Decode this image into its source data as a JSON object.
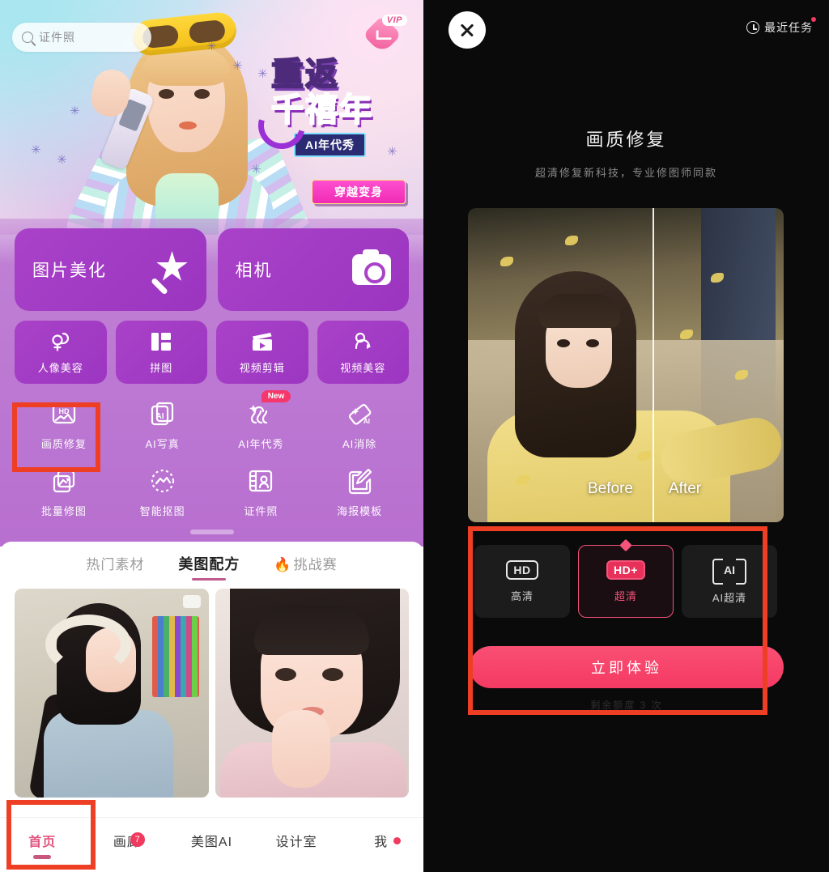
{
  "left_app": {
    "search": {
      "placeholder": "证件照",
      "icon": "search-icon"
    },
    "vip": {
      "label": "VIP",
      "icon": "vip-diamond-icon"
    },
    "banner": {
      "line1": "重返",
      "line2": "千禧年",
      "tag": "AI年代秀",
      "cta": "穿越变身"
    },
    "big_cards": [
      {
        "label": "图片美化",
        "icon": "magic-wand-icon"
      },
      {
        "label": "相机",
        "icon": "camera-icon"
      }
    ],
    "small_cards": [
      {
        "label": "人像美容",
        "icon": "portrait-beauty-icon"
      },
      {
        "label": "拼图",
        "icon": "collage-icon"
      },
      {
        "label": "视频剪辑",
        "icon": "video-clapperboard-icon"
      },
      {
        "label": "视频美容",
        "icon": "video-beauty-icon"
      }
    ],
    "grid_row1": [
      {
        "label": "画质修复",
        "icon": "hd-photo-icon",
        "badge": ""
      },
      {
        "label": "AI写真",
        "icon": "ai-portrait-icon",
        "badge": ""
      },
      {
        "label": "AI年代秀",
        "icon": "ai-era-show-icon",
        "badge": "New"
      },
      {
        "label": "AI消除",
        "icon": "ai-eraser-icon",
        "badge": ""
      }
    ],
    "grid_row2": [
      {
        "label": "批量修图",
        "icon": "batch-retouch-icon",
        "badge": ""
      },
      {
        "label": "智能抠图",
        "icon": "smart-cutout-icon",
        "badge": ""
      },
      {
        "label": "证件照",
        "icon": "id-photo-icon",
        "badge": ""
      },
      {
        "label": "海报模板",
        "icon": "poster-template-icon",
        "badge": ""
      }
    ],
    "tabs": [
      {
        "label": "热门素材",
        "active": false,
        "fire": ""
      },
      {
        "label": "美图配方",
        "active": true,
        "fire": ""
      },
      {
        "label": "挑战赛",
        "active": false,
        "fire": "🔥"
      }
    ],
    "bottom_nav": [
      {
        "label": "首页",
        "active": true,
        "badge": "",
        "dot": false
      },
      {
        "label": "画廊",
        "active": false,
        "badge": "7",
        "dot": false
      },
      {
        "label": "美图AI",
        "active": false,
        "badge": "",
        "dot": false
      },
      {
        "label": "设计室",
        "active": false,
        "badge": "",
        "dot": false
      },
      {
        "label": "我",
        "active": false,
        "badge": "",
        "dot": true
      }
    ]
  },
  "right_app": {
    "close": {
      "icon": "close-icon"
    },
    "recent_tasks": {
      "label": "最近任务",
      "icon": "history-clock-icon"
    },
    "title": "画质修复",
    "subtitle": "超清修复新科技，专业修图师同款",
    "preview": {
      "before_label": "Before",
      "after_label": "After"
    },
    "options": [
      {
        "badge": "HD",
        "label": "高清",
        "selected": false,
        "icon": "hd-badge-icon"
      },
      {
        "badge": "HD+",
        "label": "超清",
        "selected": true,
        "icon": "hd-plus-badge-icon"
      },
      {
        "badge": "AI",
        "label": "AI超清",
        "selected": false,
        "icon": "ai-bracket-icon"
      }
    ],
    "cta": "立即体验",
    "cta_note": "剩余额度 3 次"
  },
  "colors": {
    "accent_pink": "#f4537a",
    "cta_red": "#f43a63",
    "panel_purple": "#a942c8",
    "annotation_red": "#ee3f25",
    "tab_underline": "#c05a8e"
  }
}
